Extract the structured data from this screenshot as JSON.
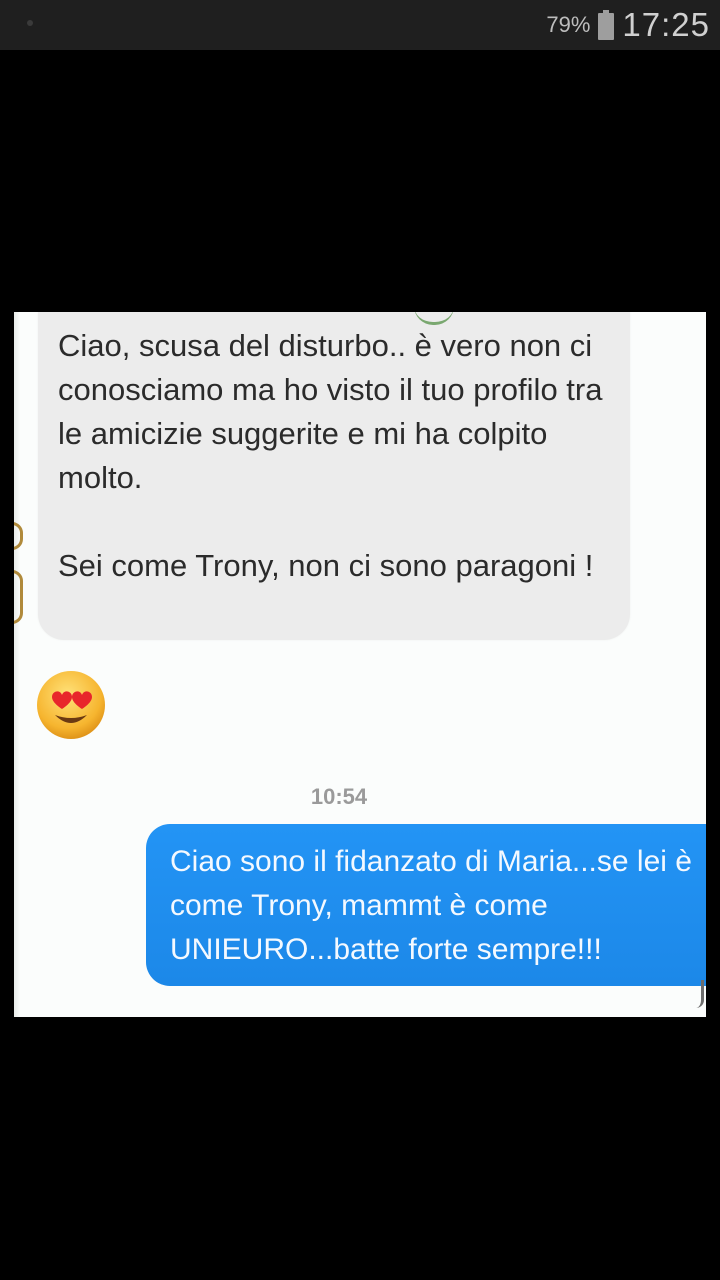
{
  "status_bar": {
    "battery_percent": "79%",
    "time": "17:25",
    "battery_icon": "battery-icon",
    "notification_dot_icon": "notification-dot-icon"
  },
  "chat": {
    "incoming_message": {
      "paragraph_1": "Ciao, scusa del disturbo.. è vero non ci conosciamo ma ho visto il tuo profilo tra le amicizie suggerite e mi ha colpito molto.",
      "paragraph_2": "Sei come Trony, non ci sono paragoni !"
    },
    "reaction_emoji": "heart-eyes-emoji",
    "timestamp": "10:54",
    "outgoing_message": "Ciao sono il fidanzato di Maria...se lei è come Trony, mammt è come UNIEURO...batte forte sempre!!!"
  },
  "colors": {
    "status_bar_bg": "#1f1f1f",
    "incoming_bubble": "#ececec",
    "outgoing_bubble": "#1f8ff0",
    "background": "#000000"
  }
}
